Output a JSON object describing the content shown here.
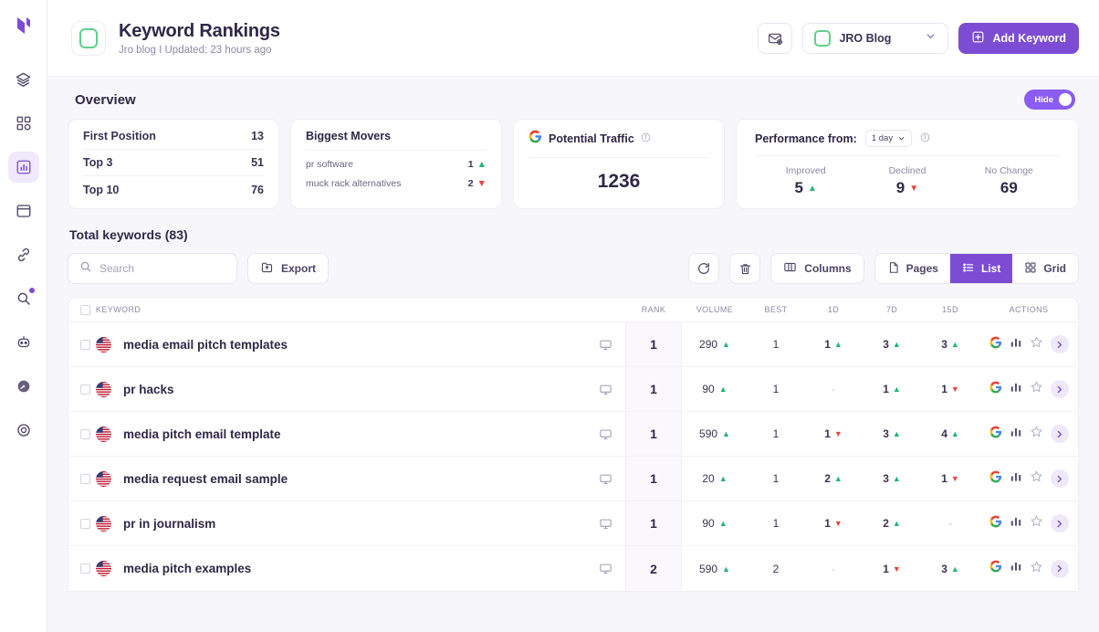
{
  "sidebar": {
    "logo_icon": "brand-logo-icon",
    "items": [
      {
        "icon": "layers-icon",
        "name": "layers",
        "active": false
      },
      {
        "icon": "apps-grid-icon",
        "name": "apps",
        "active": false
      },
      {
        "icon": "bar-chart-icon",
        "name": "rankings",
        "active": true
      },
      {
        "icon": "browser-window-icon",
        "name": "site-audit",
        "active": false
      },
      {
        "icon": "link-icon",
        "name": "backlinks",
        "active": false
      },
      {
        "icon": "search-icon",
        "name": "keyword-research",
        "active": false,
        "dot": true
      },
      {
        "icon": "robot-icon",
        "name": "ai-assistant",
        "active": false
      },
      {
        "icon": "speedometer-icon",
        "name": "performance",
        "active": false
      },
      {
        "icon": "settings-gear-icon",
        "name": "settings",
        "active": false
      }
    ]
  },
  "header": {
    "title": "Keyword Rankings",
    "subtitle": "Jro blog I Updated: 23 hours ago",
    "mail_icon": "mail-settings-icon",
    "site_selector": {
      "label": "JRO Blog",
      "chevron_icon": "chevron-down-icon"
    },
    "add_keyword": {
      "label": "Add Keyword",
      "icon": "plus-square-icon"
    }
  },
  "overview": {
    "title": "Overview",
    "hide_toggle": {
      "label": "Hide",
      "on": true
    },
    "positions": {
      "rows": [
        {
          "label": "First Position",
          "value": "13"
        },
        {
          "label": "Top 3",
          "value": "51"
        },
        {
          "label": "Top 10",
          "value": "76"
        }
      ]
    },
    "movers": {
      "title": "Biggest Movers",
      "rows": [
        {
          "keyword": "pr software",
          "value": "1",
          "dir": "up"
        },
        {
          "keyword": "muck rack alternatives",
          "value": "2",
          "dir": "down"
        }
      ]
    },
    "traffic": {
      "title": "Potential Traffic",
      "icon": "google-icon",
      "info_icon": "info-icon",
      "value": "1236"
    },
    "performance": {
      "title": "Performance from:",
      "range": "1 day",
      "chevron_icon": "chevron-down-icon",
      "info_icon": "info-icon",
      "columns": [
        {
          "label": "Improved",
          "value": "5",
          "dir": "up"
        },
        {
          "label": "Declined",
          "value": "9",
          "dir": "down"
        },
        {
          "label": "No Change",
          "value": "69",
          "dir": "none"
        }
      ]
    }
  },
  "table_section": {
    "title": "Total keywords (83)",
    "search": {
      "placeholder": "Search",
      "value": "",
      "icon": "search-icon"
    },
    "export": {
      "label": "Export",
      "icon": "export-icon"
    },
    "refresh_icon": "refresh-icon",
    "delete_icon": "trash-icon",
    "columns_btn": {
      "label": "Columns",
      "icon": "columns-icon"
    },
    "pages_btn": {
      "label": "Pages",
      "icon": "page-icon"
    },
    "list_btn": {
      "label": "List",
      "icon": "list-icon",
      "active": true
    },
    "grid_btn": {
      "label": "Grid",
      "icon": "grid-icon",
      "active": false
    },
    "headers": {
      "checkbox": "",
      "keyword": "KEYWORD",
      "rank": "RANK",
      "volume": "VOLUME",
      "best": "BEST",
      "d1": "1D",
      "d7": "7D",
      "d15": "15D",
      "actions": "ACTIONS"
    },
    "rows": [
      {
        "flag": "us-flag-icon",
        "keyword": "media email pitch templates",
        "device": "desktop-icon",
        "rank": "1",
        "volume": "290",
        "volume_dir": "up",
        "best": "1",
        "d1": "1",
        "d1_dir": "up",
        "d7": "3",
        "d7_dir": "up",
        "d15": "3",
        "d15_dir": "up"
      },
      {
        "flag": "us-flag-icon",
        "keyword": "pr hacks",
        "device": "desktop-icon",
        "rank": "1",
        "volume": "90",
        "volume_dir": "up",
        "best": "1",
        "d1": "-",
        "d1_dir": "none",
        "d7": "1",
        "d7_dir": "up",
        "d15": "1",
        "d15_dir": "down"
      },
      {
        "flag": "us-flag-icon",
        "keyword": "media pitch email template",
        "device": "desktop-icon",
        "rank": "1",
        "volume": "590",
        "volume_dir": "up",
        "best": "1",
        "d1": "1",
        "d1_dir": "down",
        "d7": "3",
        "d7_dir": "up",
        "d15": "4",
        "d15_dir": "up"
      },
      {
        "flag": "us-flag-icon",
        "keyword": "media request email sample",
        "device": "desktop-icon",
        "rank": "1",
        "volume": "20",
        "volume_dir": "up",
        "best": "1",
        "d1": "2",
        "d1_dir": "up",
        "d7": "3",
        "d7_dir": "up",
        "d15": "1",
        "d15_dir": "down"
      },
      {
        "flag": "us-flag-icon",
        "keyword": "pr in journalism",
        "device": "desktop-icon",
        "rank": "1",
        "volume": "90",
        "volume_dir": "up",
        "best": "1",
        "d1": "1",
        "d1_dir": "down",
        "d7": "2",
        "d7_dir": "up",
        "d15": "-",
        "d15_dir": "none"
      },
      {
        "flag": "us-flag-icon",
        "keyword": "media pitch examples",
        "device": "desktop-icon",
        "rank": "2",
        "volume": "590",
        "volume_dir": "up",
        "best": "2",
        "d1": "-",
        "d1_dir": "none",
        "d7": "1",
        "d7_dir": "down",
        "d15": "3",
        "d15_dir": "up"
      }
    ],
    "row_actions": {
      "google_icon": "google-icon",
      "chart_icon": "bar-chart-icon",
      "star_icon": "star-outline-icon",
      "open_icon": "chevron-right-icon"
    }
  },
  "colors": {
    "accent": "#7c4dd4",
    "accent_light": "#8b5cf1",
    "up": "#21b573",
    "down": "#e8453c",
    "page_bg": "#f7f7fb",
    "green_badge": "#5fd08a"
  }
}
